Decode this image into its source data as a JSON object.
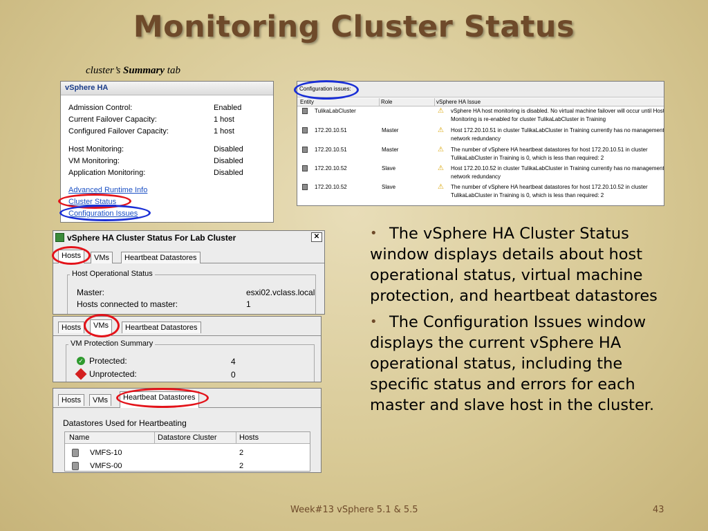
{
  "slide": {
    "title": "Monitoring Cluster Status",
    "caption_prefix": "cluster’s ",
    "caption_bold": "Summary",
    "caption_suffix": " tab",
    "footer_center": "Week#13  vSphere 5.1 & 5.5",
    "page_number": "43"
  },
  "summary_panel": {
    "header": "vSphere HA",
    "rows": [
      {
        "label": "Admission Control:",
        "value": "Enabled"
      },
      {
        "label": "Current Failover Capacity:",
        "value": "1 host"
      },
      {
        "label": "Configured Failover Capacity:",
        "value": "1 host"
      },
      {
        "label": "Host Monitoring:",
        "value": "Disabled"
      },
      {
        "label": "VM Monitoring:",
        "value": "Disabled"
      },
      {
        "label": "Application Monitoring:",
        "value": "Disabled"
      }
    ],
    "links": [
      "Advanced Runtime Info",
      "Cluster Status",
      "Configuration Issues"
    ]
  },
  "config_panel": {
    "button_label": "Configuration issues:",
    "columns": [
      "Entity",
      "Role",
      "vSphere HA Issue"
    ],
    "rows": [
      {
        "entity": "TulikaLabCluster",
        "role": "",
        "issue1": "vSphere HA host monitoring is disabled. No virtual machine failover will occur until Host",
        "issue2": "Monitoring is re-enabled for cluster TulikaLabCluster in Training"
      },
      {
        "entity": "172.20.10.51",
        "role": "Master",
        "issue1": "Host 172.20.10.51 in cluster TulikaLabCluster in Training currently has no management",
        "issue2": "network redundancy"
      },
      {
        "entity": "172.20.10.51",
        "role": "Master",
        "issue1": "The number of vSphere HA heartbeat datastores for host 172.20.10.51 in cluster",
        "issue2": "TulikaLabCluster in Training is 0, which is less than required: 2"
      },
      {
        "entity": "172.20.10.52",
        "role": "Slave",
        "issue1": "Host 172.20.10.52 in cluster TulikaLabCluster in Training currently has no management",
        "issue2": "network redundancy"
      },
      {
        "entity": "172.20.10.52",
        "role": "Slave",
        "issue1": "The number of vSphere HA heartbeat datastores for host 172.20.10.52 in cluster",
        "issue2": "TulikaLabCluster in Training is 0, which is less than required: 2"
      }
    ]
  },
  "status_window": {
    "title": "vSphere HA Cluster Status For Lab Cluster",
    "close_label": "✕",
    "tabs": [
      "Hosts",
      "VMs",
      "Heartbeat Datastores"
    ],
    "group_label": "Host Operational Status",
    "rows": [
      {
        "label": "Master:",
        "value": "esxi02.vclass.local"
      },
      {
        "label": "Hosts connected to master:",
        "value": "1"
      }
    ]
  },
  "vms_window": {
    "tabs": [
      "Hosts",
      "VMs",
      "Heartbeat Datastores"
    ],
    "group_label": "VM Protection Summary",
    "rows": [
      {
        "label": "Protected:",
        "value": "4"
      },
      {
        "label": "Unprotected:",
        "value": "0"
      }
    ]
  },
  "hb_window": {
    "tabs": [
      "Hosts",
      "VMs",
      "Heartbeat Datastores"
    ],
    "section_label": "Datastores Used for Heartbeating",
    "columns": [
      "Name",
      "Datastore Cluster",
      "Hosts"
    ],
    "rows": [
      {
        "name": "VMFS-10",
        "cluster": "",
        "hosts": "2"
      },
      {
        "name": "VMFS-00",
        "cluster": "",
        "hosts": "2"
      }
    ]
  },
  "bullets": [
    "The vSphere HA Cluster Status window displays details about host operational status, virtual machine protection, and heartbeat datastores",
    "The Configuration Issues window displays the current vSphere HA operational status, including the specific status and errors for each master and slave host in the cluster."
  ],
  "colors": {
    "title": "#6e4a2a",
    "highlight_red": "#e3131a",
    "highlight_blue": "#1a2fd6",
    "link": "#1a4fc4"
  }
}
